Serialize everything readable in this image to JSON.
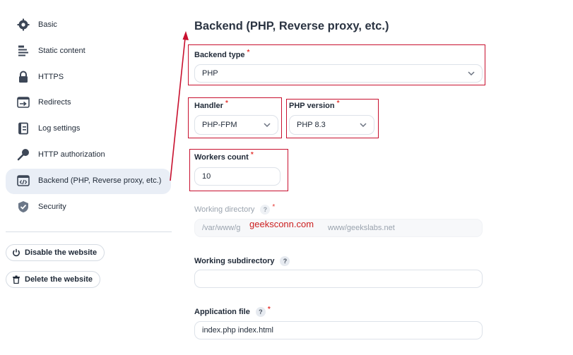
{
  "sidebar": {
    "items": [
      {
        "label": "Basic",
        "icon": "gear-icon"
      },
      {
        "label": "Static content",
        "icon": "file-text-icon"
      },
      {
        "label": "HTTPS",
        "icon": "lock-icon"
      },
      {
        "label": "Redirects",
        "icon": "redirect-arrow-icon"
      },
      {
        "label": "Log settings",
        "icon": "log-book-icon"
      },
      {
        "label": "HTTP authorization",
        "icon": "key-icon"
      },
      {
        "label": "Backend (PHP, Reverse proxy, etc.)",
        "icon": "code-window-icon",
        "active": true
      },
      {
        "label": "Security",
        "icon": "shield-check-icon"
      }
    ],
    "actions": {
      "disable_label": "Disable the website",
      "delete_label": "Delete the website"
    }
  },
  "main": {
    "title": "Backend (PHP, Reverse proxy, etc.)",
    "backend_type": {
      "label": "Backend type",
      "required": "*",
      "value": "PHP"
    },
    "handler": {
      "label": "Handler",
      "required": "*",
      "value": "PHP-FPM"
    },
    "php_version": {
      "label": "PHP version",
      "required": "*",
      "value": "PHP 8.3"
    },
    "workers_count": {
      "label": "Workers count",
      "required": "*",
      "value": "10"
    },
    "working_directory": {
      "label": "Working directory",
      "help": "?",
      "required": "*",
      "value_left": "/var/www/g",
      "value_right": "www/geekslabs.net"
    },
    "working_subdirectory": {
      "label": "Working subdirectory",
      "help": "?",
      "value": ""
    },
    "application_file": {
      "label": "Application file",
      "help": "?",
      "required": "*",
      "value": "index.php index.html"
    }
  },
  "watermark": "geeksconn.com",
  "colors": {
    "accent_red": "#c8102e",
    "active_bg": "#e9eef6",
    "border": "#dde2e9"
  }
}
